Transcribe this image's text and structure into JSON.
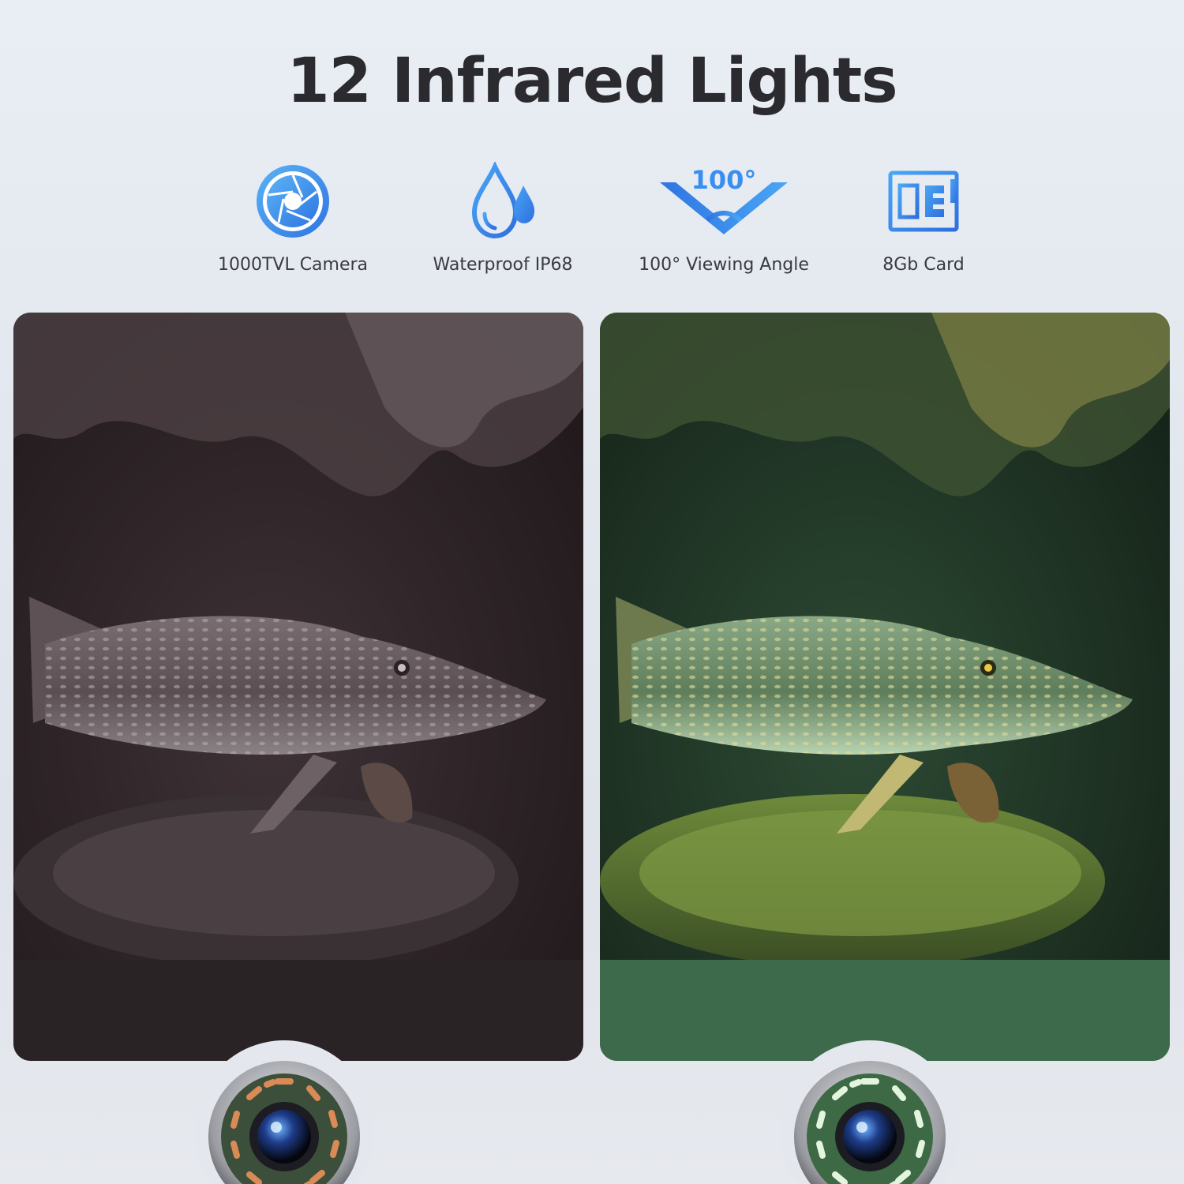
{
  "title": "12 Infrared Lights",
  "features": [
    {
      "icon": "camera-aperture-icon",
      "label": "1000TVL Camera"
    },
    {
      "icon": "water-drop-icon",
      "label": "Waterproof IP68"
    },
    {
      "icon": "viewing-angle-icon",
      "label": "100° Viewing Angle",
      "badge": "100°"
    },
    {
      "icon": "sd-card-icon",
      "label": "8Gb Card"
    }
  ],
  "colors": {
    "accent": "#2f7fe8",
    "accent_light": "#4aa6f4",
    "title": "#2b2b2f",
    "night_panel": "#2b2225",
    "lit_panel": "#1f3a27",
    "ir_led_off": "#c8703f",
    "ir_led_on": "#d9f0d6"
  },
  "panels": [
    {
      "name": "lights-off-photo",
      "subject": "pike fish underwater",
      "ir_state": "off"
    },
    {
      "name": "lights-on-photo",
      "subject": "pike fish underwater",
      "ir_state": "on"
    }
  ]
}
